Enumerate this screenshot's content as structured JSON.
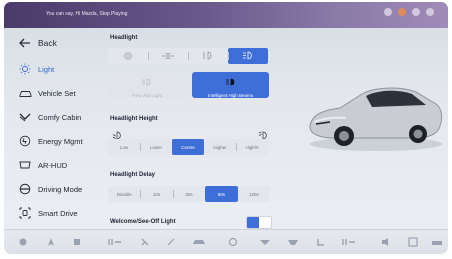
{
  "status_bar": {
    "voice_hint": "You can say, Hi Mazda, Stop Playing"
  },
  "sidebar": {
    "back_label": "Back",
    "items": [
      {
        "label": "Light",
        "icon": "light-icon",
        "active": true
      },
      {
        "label": "Vehicle Set",
        "icon": "vehicle-icon",
        "active": false
      },
      {
        "label": "Comfy Cabin",
        "icon": "seat-icon",
        "active": false
      },
      {
        "label": "Energy Mgmt",
        "icon": "energy-icon",
        "active": false
      },
      {
        "label": "AR-HUD",
        "icon": "hud-icon",
        "active": false
      },
      {
        "label": "Driving Mode",
        "icon": "steering-icon",
        "active": false
      },
      {
        "label": "Smart Drive",
        "icon": "smart-drive-icon",
        "active": false
      }
    ]
  },
  "headlight": {
    "title": "Headlight",
    "modes": [
      {
        "icon": "sun-icon",
        "selected": false
      },
      {
        "icon": "position-light-icon",
        "selected": false
      },
      {
        "icon": "low-beam-icon",
        "selected": false
      },
      {
        "icon": "auto-beam-icon",
        "selected": true
      }
    ],
    "beam_options": [
      {
        "label": "Free Way Light",
        "selected": false
      },
      {
        "label": "Intelligent High Beams",
        "selected": true
      }
    ]
  },
  "headlight_height": {
    "title": "Headlight Height",
    "options": [
      "Low",
      "Lower",
      "Centre",
      "Higher",
      "High/0"
    ],
    "selected": "Centre"
  },
  "headlight_delay": {
    "title": "Headlight Delay",
    "options": [
      "Disable",
      "10s",
      "30s",
      "60s",
      "120s"
    ],
    "selected": "60s"
  },
  "welcome_light": {
    "title": "Welcome/See-Off Light",
    "enabled": true
  },
  "colors": {
    "accent": "#3e6fd8",
    "status_bar": "#5a4a7c",
    "car_body": "#c9ccd2"
  },
  "dock": {
    "icons": [
      "home-icon",
      "navigation-icon",
      "media-icon",
      "ac-temp-icon",
      "fan-icon",
      "seat-heat-icon",
      "car-icon",
      "defrost-front-icon",
      "defrost-rear-icon",
      "heated-seat-icon",
      "steering-heat-icon",
      "ac-temp-right-icon",
      "volume-icon",
      "menu-icon",
      "phone-icon"
    ]
  }
}
